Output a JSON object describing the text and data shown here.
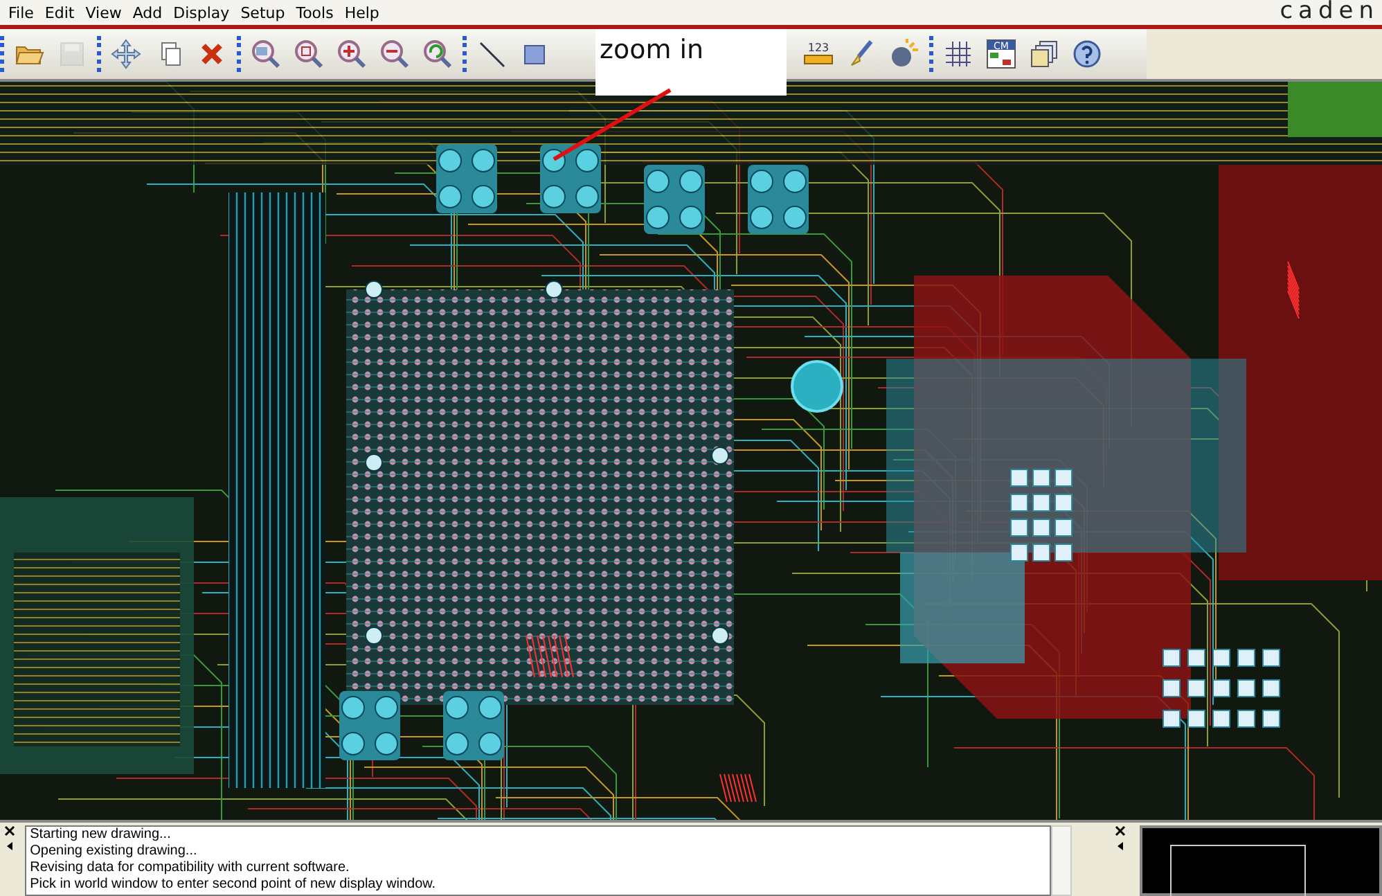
{
  "menu": [
    "File",
    "Edit",
    "View",
    "Add",
    "Display",
    "Setup",
    "Tools",
    "Help"
  ],
  "brand": "caden",
  "toolbar_groups": [
    [
      {
        "kind": "open",
        "disabled": false
      },
      {
        "kind": "save",
        "disabled": true
      }
    ],
    [
      {
        "kind": "move",
        "disabled": false
      },
      {
        "kind": "copy",
        "disabled": false
      },
      {
        "kind": "delete",
        "disabled": false
      }
    ],
    [
      {
        "kind": "zoom-fit",
        "disabled": false
      },
      {
        "kind": "zoom-box",
        "disabled": false
      },
      {
        "kind": "zoom-in",
        "disabled": false
      },
      {
        "kind": "zoom-out",
        "disabled": false
      },
      {
        "kind": "zoom-previous",
        "disabled": false
      }
    ],
    [
      {
        "kind": "line",
        "disabled": false
      },
      {
        "kind": "rectangle",
        "disabled": false
      },
      {
        "kind": "blank"
      },
      {
        "kind": "ruler",
        "disabled": false,
        "label": "123"
      },
      {
        "kind": "brush",
        "disabled": false
      },
      {
        "kind": "bomb",
        "disabled": false
      }
    ],
    [
      {
        "kind": "grid",
        "disabled": false
      },
      {
        "kind": "table",
        "disabled": false,
        "label": "CM"
      },
      {
        "kind": "windows",
        "disabled": false
      },
      {
        "kind": "help",
        "disabled": false
      }
    ]
  ],
  "callout": {
    "text": "zoom in"
  },
  "console": {
    "lines": [
      "Starting new drawing...",
      "Opening existing drawing...",
      "Revising data for compatibility with current software.",
      "Pick in world window to enter second point of new display window."
    ]
  }
}
